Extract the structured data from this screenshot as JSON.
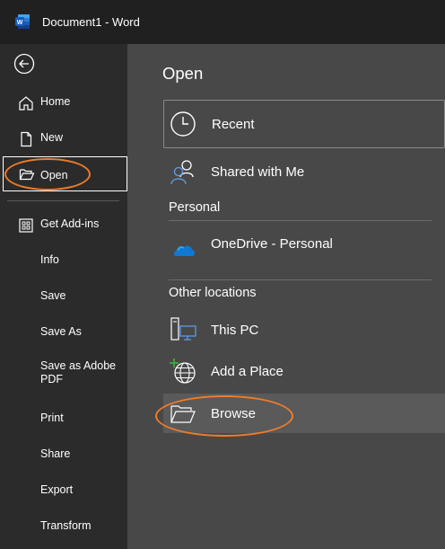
{
  "window": {
    "title": "Document1  -  Word"
  },
  "sidebar": {
    "items": [
      {
        "id": "home",
        "label": "Home"
      },
      {
        "id": "new",
        "label": "New"
      },
      {
        "id": "open",
        "label": "Open"
      },
      {
        "id": "addins",
        "label": "Get Add-ins"
      },
      {
        "id": "info",
        "label": "Info"
      },
      {
        "id": "save",
        "label": "Save"
      },
      {
        "id": "saveas",
        "label": "Save As"
      },
      {
        "id": "saveaspdf",
        "label": "Save as Adobe PDF"
      },
      {
        "id": "print",
        "label": "Print"
      },
      {
        "id": "share",
        "label": "Share"
      },
      {
        "id": "export",
        "label": "Export"
      },
      {
        "id": "transform",
        "label": "Transform"
      }
    ]
  },
  "main": {
    "title": "Open",
    "recent_label": "Recent",
    "shared_label": "Shared with Me",
    "personal_heading": "Personal",
    "onedrive_label": "OneDrive - Personal",
    "other_heading": "Other locations",
    "thispc_label": "This PC",
    "addplace_label": "Add a Place",
    "browse_label": "Browse"
  },
  "colors": {
    "titlebar": "#202020",
    "sidebar": "#2b2b2b",
    "main": "#484848",
    "accent_word": "#2b5797",
    "annotation": "#ef7c2a",
    "onedrive": "#0f78d4"
  }
}
